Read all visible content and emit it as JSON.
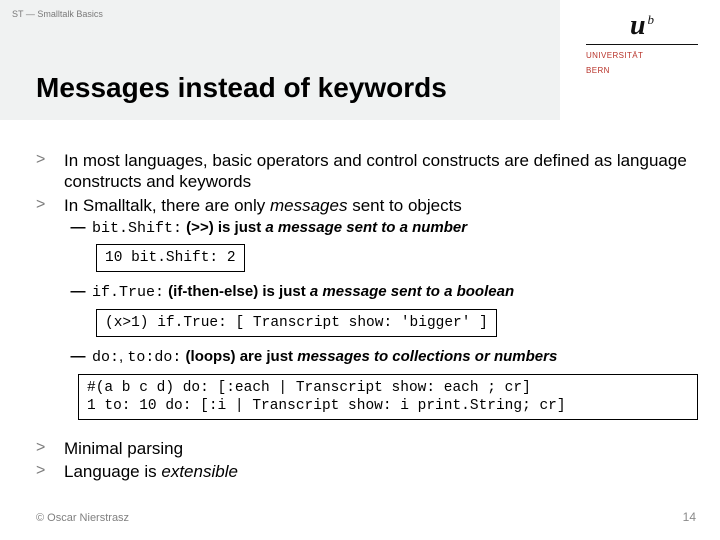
{
  "header": {
    "banner": "ST — Smalltalk Basics",
    "title": "Messages instead of keywords"
  },
  "logo": {
    "u": "u",
    "b": "b",
    "line1": "UNIVERSITÄT",
    "line2": "BERN"
  },
  "points": {
    "p1": "In most languages, basic operators and control constructs are defined as language constructs and keywords",
    "p2_a": "In Smalltalk, there are only ",
    "p2_em": "messages",
    "p2_b": " sent to objects",
    "s1_code": "bit.Shift:",
    "s1_text_a": " (>>) is just ",
    "s1_em": "a message sent to a number",
    "code1": "10 bit.Shift: 2",
    "s2_code": "if.True:",
    "s2_text_a": " (if-then-else) is just ",
    "s2_em": "a message sent to a boolean",
    "code2": "(x>1) if.True: [ Transcript show: 'bigger' ]",
    "s3_code1": "do:",
    "s3_sep": ", ",
    "s3_code2": "to:do:",
    "s3_text_a": " (loops) are just ",
    "s3_em": "messages to collections or numbers",
    "code3_l1": "#(a b c d) do: [:each | Transcript show: each ; cr]",
    "code3_l2": "1 to: 10 do: [:i | Transcript show: i print.String; cr]",
    "p3": "Minimal parsing",
    "p4_a": "Language is ",
    "p4_em": "extensible"
  },
  "footer": {
    "copyright": "© Oscar Nierstrasz",
    "page": "14"
  }
}
